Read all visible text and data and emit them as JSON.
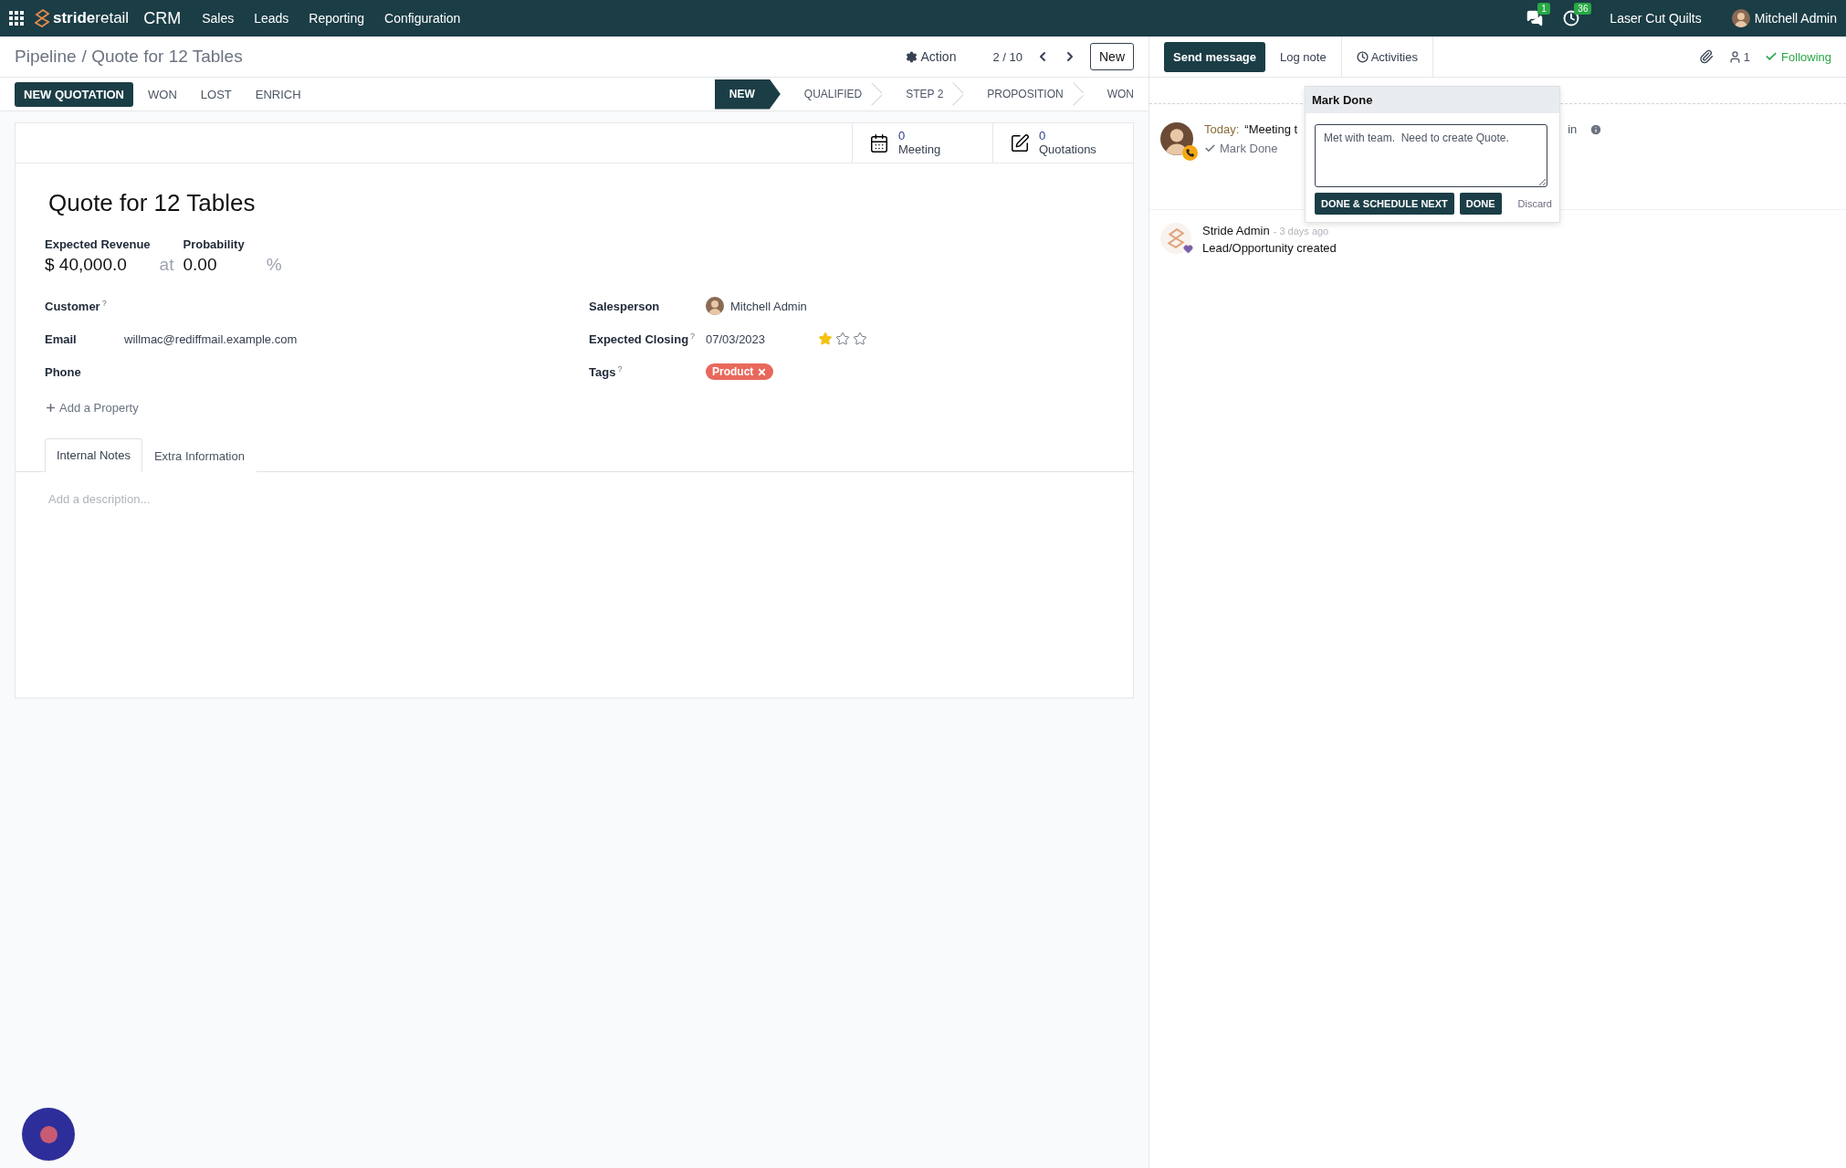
{
  "navbar": {
    "brand": "**stride**retail",
    "app": "CRM",
    "menu": [
      "Sales",
      "Leads",
      "Reporting",
      "Configuration"
    ],
    "messages_count": "1",
    "activities_count": "36",
    "company": "Laser Cut Quilts",
    "user": "Mitchell Admin"
  },
  "breadcrumb": {
    "parent": "Pipeline",
    "separator": "/",
    "current": "Quote for 12 Tables"
  },
  "control": {
    "action": "Action",
    "pager": "2 / 10",
    "new": "New"
  },
  "header_buttons": [
    {
      "label": "NEW QUOTATION",
      "kind": "primary"
    },
    {
      "label": "WON",
      "kind": "link"
    },
    {
      "label": "LOST",
      "kind": "link"
    },
    {
      "label": "ENRICH",
      "kind": "link"
    }
  ],
  "stages": [
    {
      "label": "NEW",
      "selected": true
    },
    {
      "label": "QUALIFIED",
      "selected": false
    },
    {
      "label": "STEP 2",
      "selected": false
    },
    {
      "label": "PROPOSITION",
      "selected": false
    },
    {
      "label": "WON",
      "selected": false
    }
  ],
  "smart_buttons": [
    {
      "count": "0",
      "label": "Meeting",
      "kind": "calendar"
    },
    {
      "count": "0",
      "label": "Quotations",
      "kind": "edit"
    }
  ],
  "form": {
    "title": "Quote for 12 Tables",
    "revenue_label": "Expected Revenue",
    "revenue": "$ 40,000.0",
    "at": "at",
    "probability_label": "Probability",
    "probability": "0.00",
    "percent": "%",
    "left_fields": [
      {
        "label": "Customer",
        "help": "?"
      },
      {
        "label": "Email",
        "value": "willmac@rediffmail.example.com"
      },
      {
        "label": "Phone"
      }
    ],
    "right_fields": [
      {
        "label": "Salesperson",
        "kind": "user",
        "value": "Mitchell Admin"
      },
      {
        "label": "Expected Closing",
        "help": "?",
        "kind": "date",
        "value": "07/03/2023",
        "stars": 1
      },
      {
        "label": "Tags",
        "help": "?",
        "kind": "tags",
        "tags": [
          {
            "label": "Product",
            "color": "#e8695b"
          }
        ]
      }
    ],
    "add_property": "Add a Property",
    "tabs": [
      {
        "label": "Internal Notes",
        "selected": true
      },
      {
        "label": "Extra Information",
        "selected": false
      }
    ],
    "description_placeholder": "Add a description..."
  },
  "chatter": {
    "send_message": "Send message",
    "log_note": "Log note",
    "activities": "Activities",
    "followers_count": "1",
    "following": "Following",
    "activity": {
      "date_label": "Today:",
      "summary": "“Meeting t",
      "tail": "in",
      "mark_done": "Mark Done"
    },
    "popover": {
      "title": "Mark Done",
      "feedback": "Met with team.  Need to create Quote.",
      "buttons": [
        "DONE & SCHEDULE NEXT",
        "DONE"
      ],
      "discard": "Discard"
    },
    "message": {
      "author": "Stride Admin",
      "date": "- 3 days ago",
      "body": "Lead/Opportunity created"
    }
  }
}
